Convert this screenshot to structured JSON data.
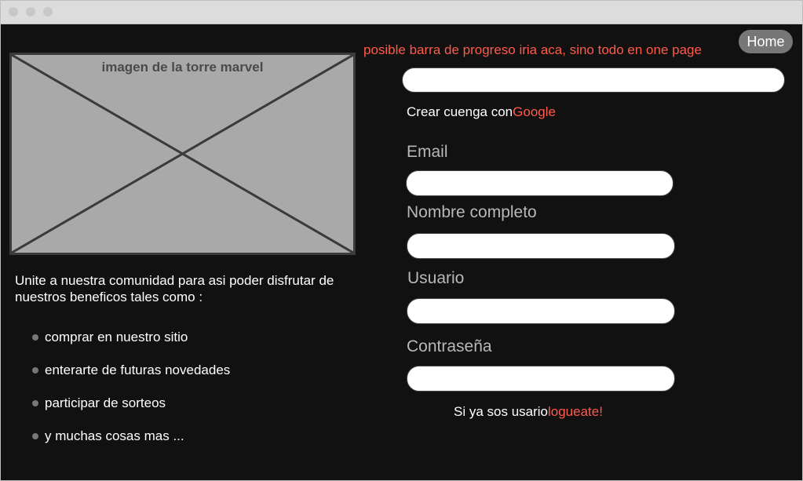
{
  "header": {
    "home_label": "Home",
    "progress_note": "posible barra de progreso iria aca, sino todo en one page"
  },
  "hero": {
    "image_label": "imagen de la torre marvel",
    "intro_text": "Unite a nuestra comunidad para asi poder disfrutar de nuestros beneficos tales como :",
    "benefits": [
      "comprar en nuestro sitio",
      "enterarte de futuras novedades",
      "participar de sorteos",
      "y muchas cosas mas ..."
    ]
  },
  "form": {
    "google_prefix": "Crear cuenga con",
    "google_link": "Google",
    "email_label": "Email",
    "fullname_label": "Nombre completo",
    "username_label": "Usuario",
    "password_label": "Contraseña",
    "login_prefix": "Si ya sos usario",
    "login_link": "logueate!"
  },
  "colors": {
    "background": "#111111",
    "accent": "#ff5a4a",
    "label": "#b8b8b8",
    "placeholder_fill": "#a9a9a9"
  }
}
